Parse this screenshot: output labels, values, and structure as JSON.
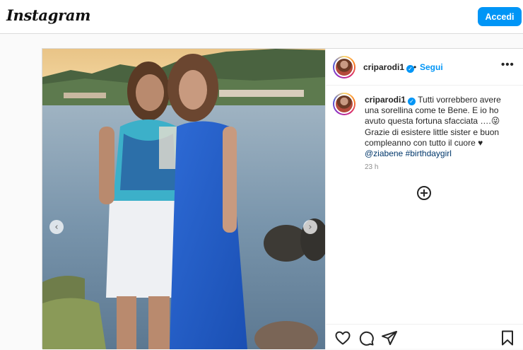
{
  "header": {
    "logo": "Instagram",
    "login_label": "Accedi"
  },
  "post": {
    "author": {
      "username": "criparodi1",
      "verified": true,
      "separator": "•",
      "follow_label": "Segui"
    },
    "more_label": "•••",
    "caption": {
      "username": "criparodi1",
      "text": " Tutti vorrebbero avere una sorellina come te Bene. E io ho avuto questa fortuna sfacciata ….😜 Grazie di esistere little sister e buon compleanno con tutto il cuore ♥",
      "mention": "@ziabene",
      "hashtag": "#birthdaygirl"
    },
    "time_ago": "23 h",
    "nav": {
      "prev": "‹",
      "next": "›"
    },
    "verified_mark": "✓"
  },
  "icons": [
    "heart-icon",
    "comment-icon",
    "share-icon",
    "bookmark-icon",
    "add-comment-icon",
    "more-icon",
    "verified-icon"
  ],
  "colors": {
    "accent": "#0095f6",
    "text": "#262626",
    "muted": "#8e8e8e",
    "border": "#dbdbdb",
    "link": "#00376b"
  }
}
